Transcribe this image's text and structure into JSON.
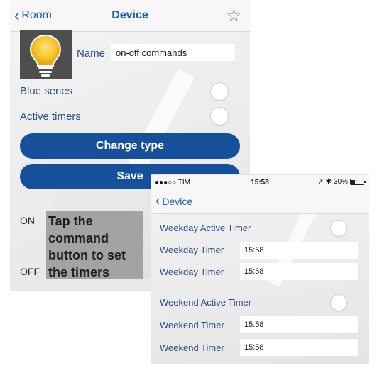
{
  "device_screen": {
    "nav": {
      "back_label": "Room",
      "title": "Device",
      "favorite_icon": "star-outline-icon"
    },
    "icon": {
      "name": "light-bulb-icon",
      "color": "#f7c52a"
    },
    "name_field": {
      "label": "Name",
      "value": "on-off commands"
    },
    "blue_series": {
      "label": "Blue series",
      "on": false
    },
    "active_timers": {
      "label": "Active timers",
      "on": false
    },
    "change_type_label": "Change type",
    "save_label": "Save",
    "on_label": "ON",
    "off_label": "OFF"
  },
  "callout": {
    "text": "Tap the command button to set the timers"
  },
  "timer_screen": {
    "status_bar": {
      "carrier": "●●●○○ TIM",
      "time": "15:58",
      "battery_text": "30%"
    },
    "nav": {
      "back_label": "Device"
    },
    "weekday_active": {
      "label": "Weekday Active Timer",
      "on": false
    },
    "weekday_timer_1": {
      "label": "Weekday Timer",
      "value": "15:58"
    },
    "weekday_timer_2": {
      "label": "Weekday Timer",
      "value": "15:58"
    },
    "weekend_active": {
      "label": "Weekend Active Timer",
      "on": false
    },
    "weekend_timer_1": {
      "label": "Weekend Timer",
      "value": "15:58"
    },
    "weekend_timer_2": {
      "label": "Weekend Timer",
      "value": "15:58"
    }
  },
  "colors": {
    "accent": "#1a5fb4",
    "button": "#17509a",
    "label": "#2a4e82",
    "callout_bg": "#a3a3a3"
  }
}
